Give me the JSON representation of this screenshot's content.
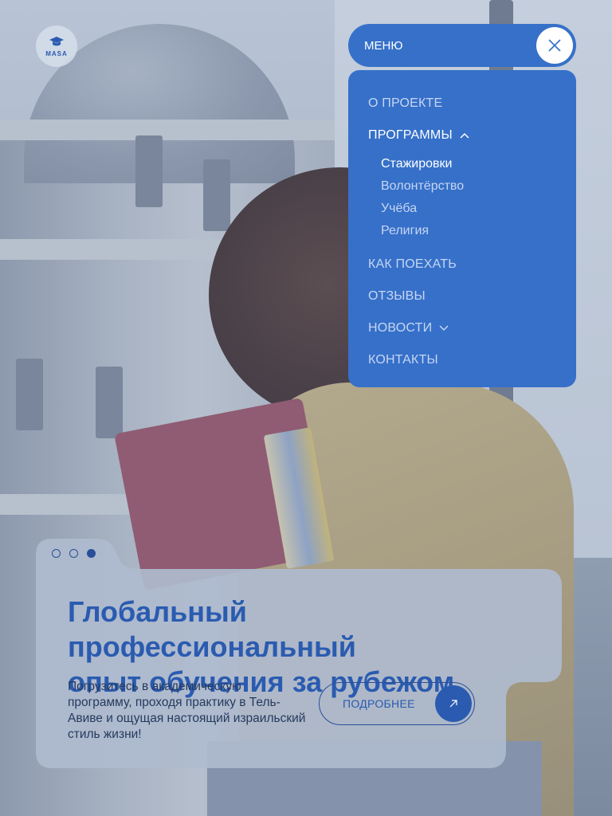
{
  "logo": {
    "text": "MASA"
  },
  "menu": {
    "label": "МЕНЮ",
    "items": [
      {
        "label": "О ПРОЕКТЕ"
      },
      {
        "label": "ПРОГРАММЫ",
        "expanded": true,
        "subitems": [
          {
            "label": "Стажировки",
            "active": true
          },
          {
            "label": "Волонтёрство"
          },
          {
            "label": "Учёба"
          },
          {
            "label": "Религия"
          }
        ]
      },
      {
        "label": "КАК ПОЕХАТЬ"
      },
      {
        "label": "ОТЗЫВЫ"
      },
      {
        "label": "НОВОСТИ",
        "expandable": true
      },
      {
        "label": "КОНТАКТЫ"
      }
    ]
  },
  "hero": {
    "slides_total": 3,
    "active_slide": 3,
    "headline_line1": "Глобальный профессиональный",
    "headline_line2": "опыт обучения за рубежом",
    "description": "Погрузитесь в академическую программу, проходя практику в Тель-Авиве и ощущая настоящий израильский стиль жизни!",
    "cta_label": "ПОДРОБНЕЕ"
  },
  "colors": {
    "accent": "#3670c9",
    "primary_text": "#2a5bb0",
    "card_background": "#aebacd"
  },
  "icons": {
    "logo": "graduation-cap-icon",
    "close": "close-icon",
    "chevron_up": "chevron-up-icon",
    "chevron_down": "chevron-down-icon",
    "cta_arrow": "arrow-up-right-icon"
  }
}
